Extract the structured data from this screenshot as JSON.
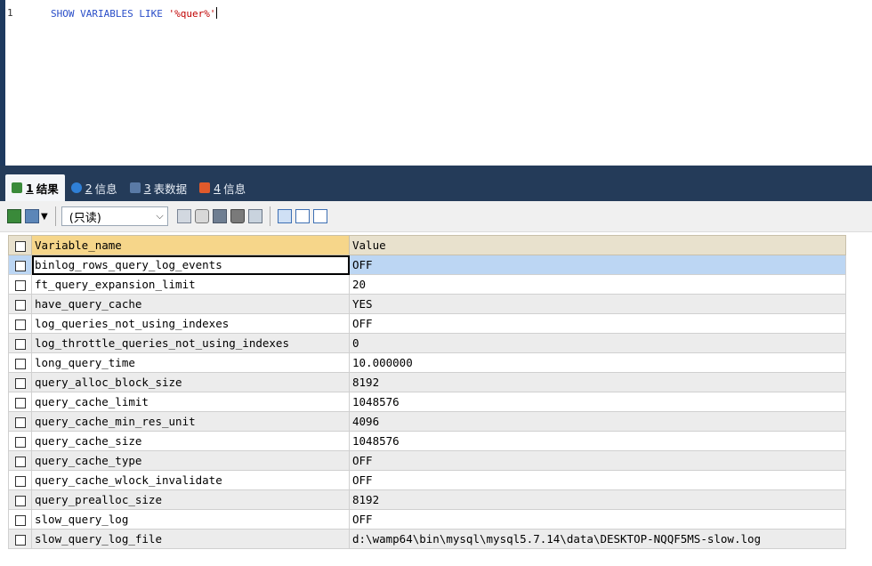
{
  "editor": {
    "line_number": "1",
    "sql_prefix": "SHOW VARIABLES LIKE ",
    "sql_string": "'%quer%'"
  },
  "tabs": [
    {
      "num": "1",
      "label": "结果",
      "icon": "grid-icon",
      "color": "#3a8a3a"
    },
    {
      "num": "2",
      "label": "信息",
      "icon": "info-icon",
      "color": "#2f7fd6"
    },
    {
      "num": "3",
      "label": "表数据",
      "icon": "table-icon",
      "color": "#5a7aa6"
    },
    {
      "num": "4",
      "label": "信息",
      "icon": "chart-icon",
      "color": "#e05a2b"
    }
  ],
  "toolbar": {
    "readonly_label": "(只读)"
  },
  "grid": {
    "columns": [
      "Variable_name",
      "Value"
    ],
    "rows": [
      [
        "binlog_rows_query_log_events",
        "OFF"
      ],
      [
        "ft_query_expansion_limit",
        "20"
      ],
      [
        "have_query_cache",
        "YES"
      ],
      [
        "log_queries_not_using_indexes",
        "OFF"
      ],
      [
        "log_throttle_queries_not_using_indexes",
        "0"
      ],
      [
        "long_query_time",
        "10.000000"
      ],
      [
        "query_alloc_block_size",
        "8192"
      ],
      [
        "query_cache_limit",
        "1048576"
      ],
      [
        "query_cache_min_res_unit",
        "4096"
      ],
      [
        "query_cache_size",
        "1048576"
      ],
      [
        "query_cache_type",
        "OFF"
      ],
      [
        "query_cache_wlock_invalidate",
        "OFF"
      ],
      [
        "query_prealloc_size",
        "8192"
      ],
      [
        "slow_query_log",
        "OFF"
      ],
      [
        "slow_query_log_file",
        "d:\\wamp64\\bin\\mysql\\mysql5.7.14\\data\\DESKTOP-NQQF5MS-slow.log"
      ]
    ]
  },
  "colors": {
    "tab_bar": "#243b59",
    "header_highlight": "#f6d68a",
    "selected_row": "#bcd6f3"
  }
}
